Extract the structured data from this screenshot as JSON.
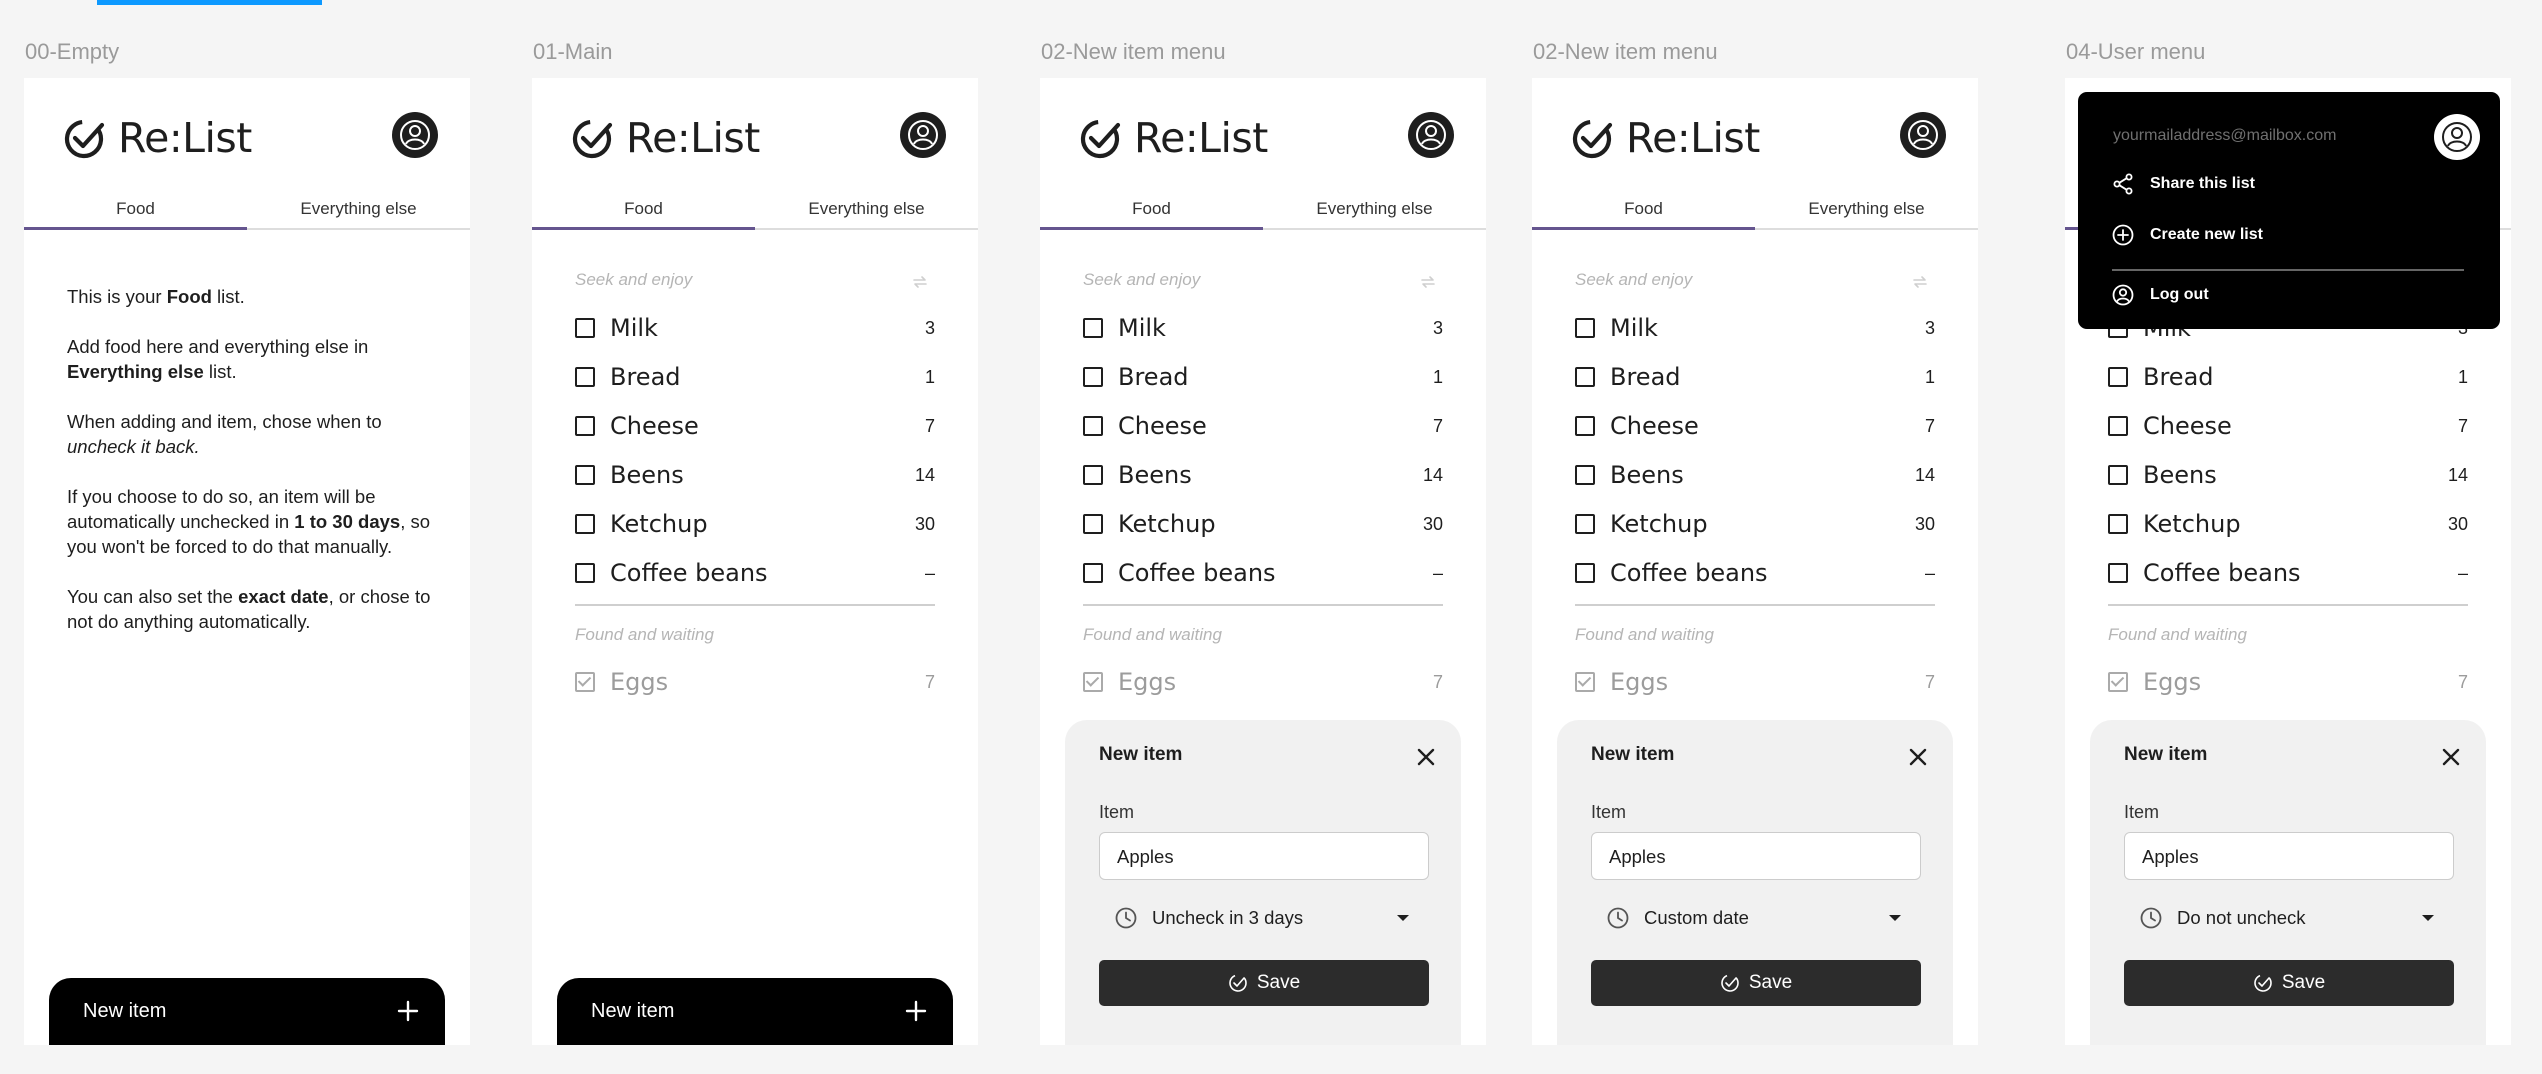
{
  "frames": [
    {
      "label": "00-Empty"
    },
    {
      "label": "01-Main"
    },
    {
      "label": "02-New item menu"
    },
    {
      "label": "02-New item menu"
    },
    {
      "label": "04-User menu"
    }
  ],
  "app": {
    "title": "Re:List"
  },
  "tabs": {
    "food": "Food",
    "else": "Everything else"
  },
  "empty": {
    "p1_a": "This is your ",
    "p1_b": "Food",
    "p1_c": " list.",
    "p2_a": "Add food here and everything else in ",
    "p2_b": "Everything else",
    "p2_c": " list.",
    "p3_a": "When adding and item, chose when to ",
    "p3_b": "uncheck it back.",
    "p4_a": "If you choose to do so, an item will be automatically unchecked in ",
    "p4_b": "1 to 30 days",
    "p4_c": ", so you won't be forced to do that manually.",
    "p5_a": "You can also set the ",
    "p5_b": "exact date",
    "p5_c": ", or chose to not do anything automatically."
  },
  "list": {
    "seek_label": "Seek and enjoy",
    "found_label": "Found and waiting",
    "items": [
      {
        "name": "Milk",
        "count": "3"
      },
      {
        "name": "Bread",
        "count": "1"
      },
      {
        "name": "Cheese",
        "count": "7"
      },
      {
        "name": "Beens",
        "count": "14"
      },
      {
        "name": "Ketchup",
        "count": "30"
      },
      {
        "name": "Coffee beans",
        "count": "–"
      }
    ],
    "done_items": [
      {
        "name": "Eggs",
        "count": "7"
      }
    ]
  },
  "new_item_bar": {
    "label": "New item"
  },
  "sheet": {
    "title": "New item",
    "item_label": "Item",
    "item_value": "Apples",
    "save_label": "Save",
    "options": [
      "Uncheck in 3 days",
      "Custom date",
      "Do not uncheck"
    ]
  },
  "user_menu": {
    "email": "yourmailaddress@mailbox.com",
    "share": "Share this list",
    "create": "Create new list",
    "logout": "Log out"
  },
  "colors": {
    "accent": "#65558f",
    "selection": "#0d99ff",
    "dark": "#2c2c2c"
  }
}
